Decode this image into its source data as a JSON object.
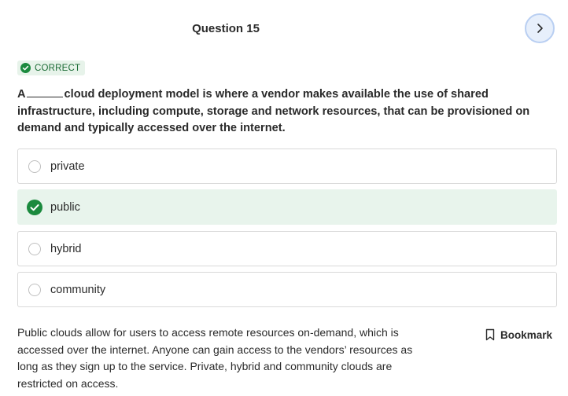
{
  "header": {
    "question_title": "Question 15",
    "next_icon": "chevron-right-icon"
  },
  "status": {
    "label": "CORRECT",
    "icon": "check-circle-icon",
    "color": "#1b8a3e"
  },
  "question": {
    "prefix": "A",
    "text": "cloud deployment model is where a vendor makes available the use of shared infrastructure, including compute, storage and network resources, that can be provisioned on demand and typically accessed over the internet."
  },
  "options": [
    {
      "label": "private",
      "selected": false
    },
    {
      "label": "public",
      "selected": true
    },
    {
      "label": "hybrid",
      "selected": false
    },
    {
      "label": "community",
      "selected": false
    }
  ],
  "explanation": {
    "text": "Public clouds allow for users to access remote resources on-demand, which is accessed over the internet. Anyone can gain access to the vendors’ resources as long as they sign up to the service. Private, hybrid and community clouds are restricted on access."
  },
  "bookmark": {
    "label": "Bookmark",
    "icon": "bookmark-icon"
  },
  "colors": {
    "accent_green": "#1b8a3e",
    "selected_bg": "#e8f4ec",
    "next_button_bg": "#e7effb"
  }
}
